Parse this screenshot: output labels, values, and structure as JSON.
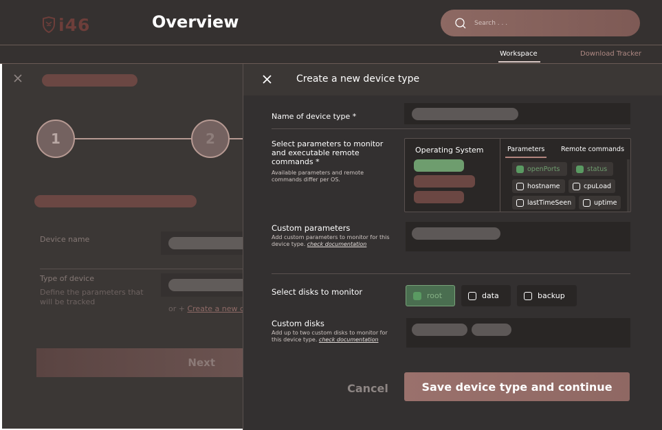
{
  "app": {
    "logo_text": "i46",
    "page_title": "Overview"
  },
  "search": {
    "placeholder": "Search . . ."
  },
  "subnav": {
    "workspace": "Workspace",
    "download_tracker": "Download Tracker"
  },
  "wizard": {
    "step1": "1",
    "step2": "2",
    "device_name_label": "Device name",
    "type_label": "Type of device",
    "type_help": "Define the parameters that will be tracked",
    "create_prefix": "or + ",
    "create_link": "Create a new device type",
    "next_label": "Next"
  },
  "modal": {
    "title": "Create a new device type",
    "name_label": "Name of device type *",
    "params_label": "Select parameters to monitor and executable remote commands *",
    "params_help": "Available parameters and remote commands differ per OS.",
    "os_title": "Operating System",
    "os_colors": [
      "#6e9d6e",
      "#6b4743",
      "#6b4743"
    ],
    "tabs": {
      "parameters": "Parameters",
      "remote_commands": "Remote commands"
    },
    "parameters": [
      {
        "label": "openPorts",
        "checked": true
      },
      {
        "label": "status",
        "checked": true
      },
      {
        "label": "hostname",
        "checked": false
      },
      {
        "label": "cpuLoad",
        "checked": false
      },
      {
        "label": "lastTimeSeen",
        "checked": false
      },
      {
        "label": "uptime",
        "checked": false
      }
    ],
    "custom_params_label": "Custom parameters",
    "custom_params_help": "Add custom parameters to monitor for this device type.",
    "doc_link": "check documentation",
    "disks_label": "Select disks to monitor",
    "disks": [
      {
        "label": "root",
        "checked": true
      },
      {
        "label": "data",
        "checked": false
      },
      {
        "label": "backup",
        "checked": false
      }
    ],
    "custom_disks_label": "Custom disks",
    "custom_disks_help": "Add up to two custom disks to monitor for this device type.",
    "cancel_label": "Cancel",
    "save_label": "Save device type and continue"
  },
  "colors": {
    "accent": "#9a716c",
    "success": "#5a9a62",
    "background": "#333030"
  }
}
